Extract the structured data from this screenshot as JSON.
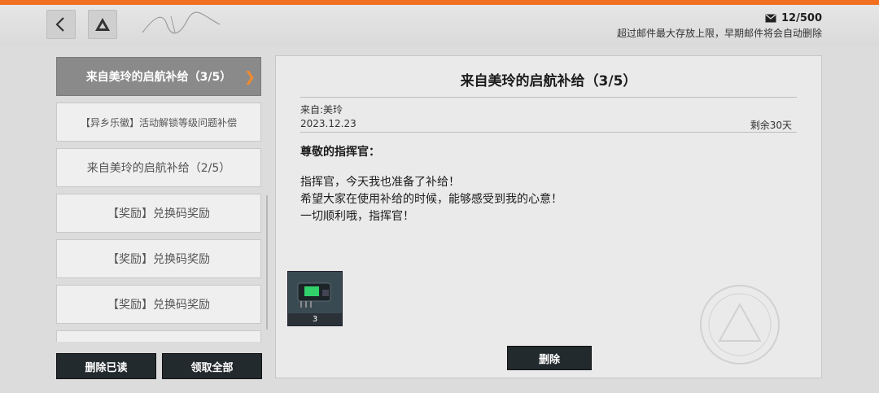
{
  "header": {
    "mail_count": "12/500",
    "mail_note": "超过邮件最大存放上限，早期邮件将会自动删除"
  },
  "mail_list": [
    {
      "title": "来自美玲的启航补给（3/5）",
      "active": true
    },
    {
      "title": "【异乡乐徽】活动解锁等级问题补偿",
      "active": false
    },
    {
      "title": "来自美玲的启航补给（2/5）",
      "active": false
    },
    {
      "title": "【奖励】兑换码奖励",
      "active": false
    },
    {
      "title": "【奖励】兑换码奖励",
      "active": false
    },
    {
      "title": "【奖励】兑换码奖励",
      "active": false
    },
    {
      "title": "",
      "active": false
    }
  ],
  "actions": {
    "delete_read": "删除已读",
    "claim_all": "领取全部",
    "delete": "删除"
  },
  "mail": {
    "title": "来自美玲的启航补给（3/5）",
    "from": "来自:美玲",
    "date": "2023.12.23",
    "remaining": "剩余30天",
    "greeting": "尊敬的指挥官：",
    "body": [
      "指挥官，今天我也准备了补给！",
      "希望大家在使用补给的时候，能够感受到我的心意！",
      "一切顺利哦，指挥官！"
    ],
    "reward": {
      "icon": "chip-item-icon",
      "quantity": "3"
    }
  },
  "colors": {
    "accent": "#f07020",
    "active_item": "#8a8a8a",
    "dark_button": "#232a2e"
  }
}
